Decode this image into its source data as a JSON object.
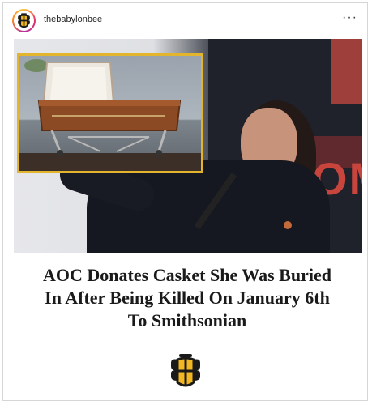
{
  "post": {
    "username": "thebabylonbee",
    "more_icon": "more-horizontal-icon",
    "more_glyph": "···"
  },
  "image": {
    "description_icon": "news-photo",
    "inset_border_color": "#e3b42e"
  },
  "headline": {
    "line1": "AOC Donates Casket She Was Buried",
    "line2": "In After Being Killed On January 6th",
    "line3": "To Smithsonian"
  },
  "brand": {
    "logo_icon": "babylon-bee-logo-icon",
    "accent_color": "#f2b823",
    "dark_color": "#1a1a1a"
  }
}
